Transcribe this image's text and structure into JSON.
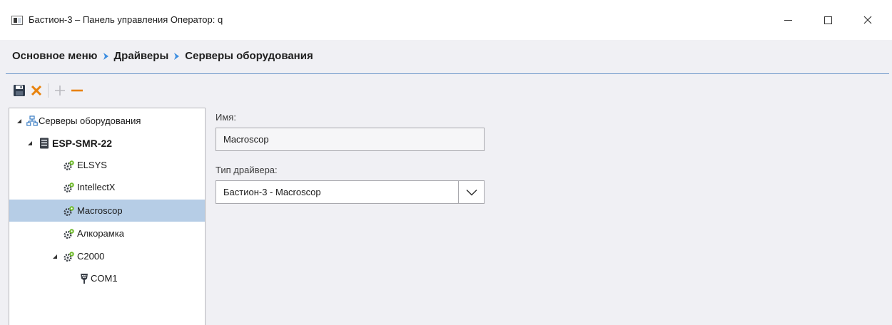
{
  "window": {
    "title": "Бастион-3 – Панель управления Оператор: q",
    "icon": "app-window-icon",
    "controls": [
      "minimize-icon",
      "maximize-icon",
      "close-icon"
    ]
  },
  "breadcrumb": {
    "items": [
      "Основное меню",
      "Драйверы",
      "Серверы оборудования"
    ],
    "separator_icon": "chevron-right-icon",
    "separator_color": "#3d8ee0"
  },
  "toolbar": {
    "buttons": [
      {
        "icon": "save-icon",
        "enabled": true
      },
      {
        "icon": "cancel-icon",
        "enabled": true,
        "color": "#e8820c"
      },
      {
        "icon": "add-icon",
        "enabled": false
      },
      {
        "icon": "remove-icon",
        "enabled": true,
        "color": "#e8820c"
      }
    ]
  },
  "tree": {
    "items": [
      {
        "label": "Серверы оборудования",
        "level": 0,
        "expanded": true,
        "icon": "network-icon"
      },
      {
        "label": "ESP-SMR-22",
        "level": 1,
        "expanded": true,
        "icon": "server-icon"
      },
      {
        "label": "ELSYS",
        "level": 2,
        "icon": "driver-gear-icon"
      },
      {
        "label": "IntellectX",
        "level": 2,
        "icon": "driver-gear-icon"
      },
      {
        "label": "Macroscop",
        "level": 2,
        "icon": "driver-gear-icon",
        "selected": true
      },
      {
        "label": "Алкорамка",
        "level": 2,
        "icon": "driver-gear-icon"
      },
      {
        "label": "C2000",
        "level": 2,
        "expanded": true,
        "icon": "driver-gear-icon"
      },
      {
        "label": "COM1",
        "level": 3,
        "icon": "com-port-icon"
      }
    ]
  },
  "form": {
    "name_label": "Имя:",
    "name_value": "Macroscop",
    "driver_type_label": "Тип драйвера:",
    "driver_type_value": "Бастион-3 - Macroscop"
  },
  "colors": {
    "accent": "#6d97c9",
    "selection": "#b6cde6",
    "orange": "#e8820c"
  }
}
